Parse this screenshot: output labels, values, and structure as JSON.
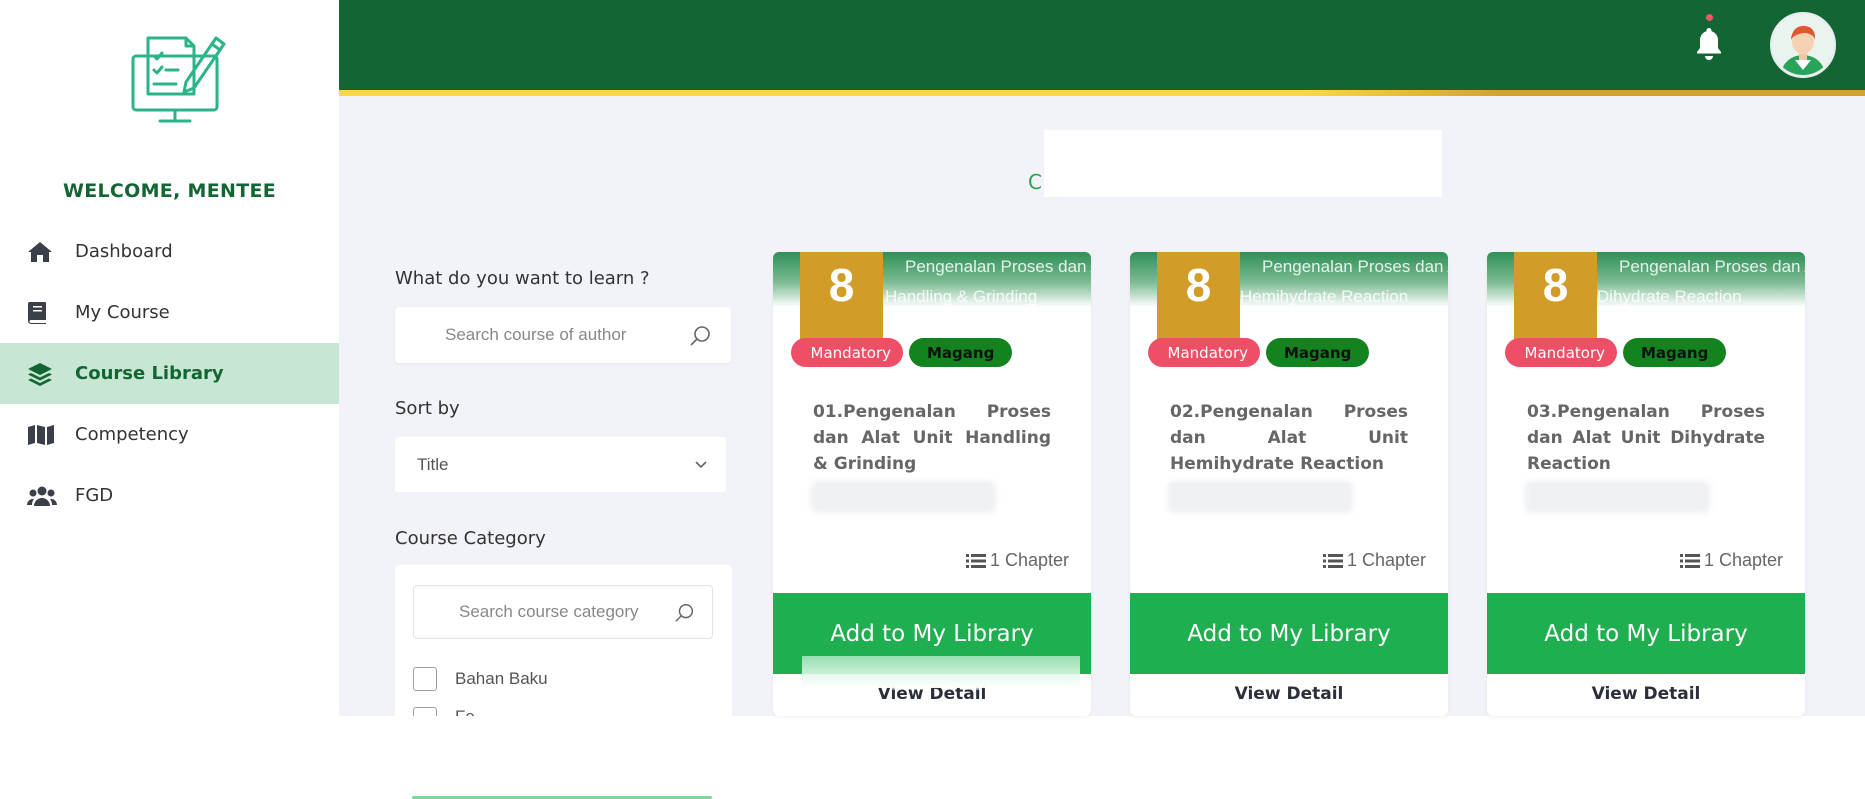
{
  "sidebar": {
    "welcome": "WELCOME, MENTEE",
    "items": [
      {
        "label": "Dashboard",
        "icon": "home-icon"
      },
      {
        "label": "My Course",
        "icon": "book-icon"
      },
      {
        "label": "Course Library",
        "icon": "layers-icon",
        "active": true
      },
      {
        "label": "Competency",
        "icon": "map-icon"
      },
      {
        "label": "FGD",
        "icon": "users-icon"
      }
    ]
  },
  "header": {
    "bell_icon": "bell-icon",
    "has_notification": true
  },
  "page": {
    "title_visible": "C"
  },
  "filters": {
    "learn_label": "What do you want to learn ?",
    "search_placeholder": "Search course of author",
    "sort_label": "Sort by",
    "sort_value": "Title",
    "category_label": "Course Category",
    "category_search_placeholder": "Search course category",
    "categories": [
      {
        "label": "Bahan Baku",
        "checked": false
      },
      {
        "label": "Fe...",
        "checked": false
      }
    ]
  },
  "courses": [
    {
      "ribbon": "8",
      "thumb_line1": "Pengenalan Proses dan Alat",
      "thumb_line2": "Handling & Grinding",
      "tag1": "Mandatory",
      "tag2": "Magang",
      "title": "01.Pengenalan Proses dan Alat Unit Handling & Grinding",
      "chapters": "1 Chapter",
      "add_label": "Add to My Library",
      "detail_label": "View Detail"
    },
    {
      "ribbon": "8",
      "thumb_line1": "Pengenalan Proses dan Alat",
      "thumb_line2": "Hemihydrate Reaction",
      "tag1": "Mandatory",
      "tag2": "Magang",
      "title": "02.Pengenalan Proses dan Alat Unit Hemihydrate Reaction",
      "chapters": "1 Chapter",
      "add_label": "Add to My Library",
      "detail_label": "View Detail"
    },
    {
      "ribbon": "8",
      "thumb_line1": "Pengenalan Proses dan Alat",
      "thumb_line2": "Dihydrate Reaction",
      "tag1": "Mandatory",
      "tag2": "Magang",
      "title": "03.Pengenalan Proses dan Alat Unit Dihydrate Reaction",
      "chapters": "1 Chapter",
      "add_label": "Add to My Library",
      "detail_label": "View Detail"
    }
  ],
  "colors": {
    "brand_green": "#136534",
    "accent_yellow": "#f5d94a",
    "button_green": "#1fae50",
    "ribbon_gold": "#d19c27",
    "tag_red": "#ee4f67",
    "tag_green": "#12831f",
    "active_nav_bg": "#c8e6d4"
  }
}
